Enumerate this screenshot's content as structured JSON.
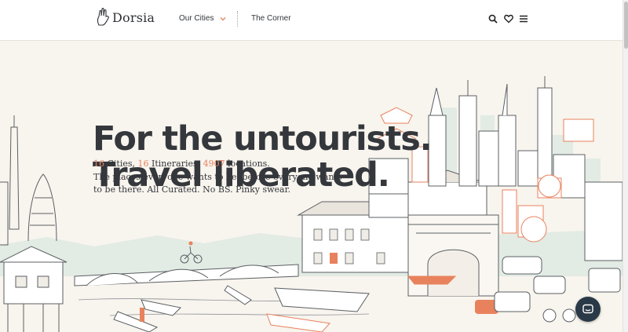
{
  "header": {
    "brand": "Dorsia",
    "nav": {
      "cities_label": "Our Cities",
      "corner_label": "The Corner"
    },
    "icons": [
      "search-icon",
      "heart-icon",
      "menu-icon"
    ]
  },
  "hero": {
    "headline_line1": "For the untourists.",
    "headline_line2": "Travel liberated.",
    "stats": {
      "cities_count": "16",
      "cities_label": " Cities, ",
      "itineraries_count": "16",
      "itineraries_label": " Itineraries, ",
      "locations_count": "4907",
      "locations_label": " locations."
    },
    "tagline": "The places everyone wants to be, before everyone wants to be there. All Curated. No BS. Pinky swear."
  },
  "colors": {
    "accent": "#e8825d",
    "text": "#34373b",
    "background": "#f8f4ee",
    "chat_button": "#2a3947"
  }
}
